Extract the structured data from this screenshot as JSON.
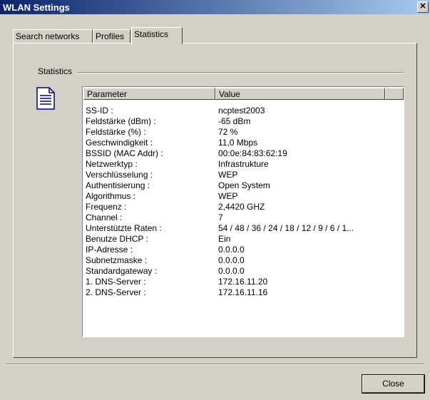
{
  "window": {
    "title": "WLAN Settings",
    "close_glyph": "✕"
  },
  "tabs": [
    {
      "label": "Search networks",
      "active": false
    },
    {
      "label": "Profiles",
      "active": false
    },
    {
      "label": "Statistics",
      "active": true
    }
  ],
  "group": {
    "label": "Statistics",
    "icon": "document-icon"
  },
  "table": {
    "headers": [
      "Parameter",
      "Value"
    ],
    "rows": [
      [
        "SS-ID :",
        "ncptest2003"
      ],
      [
        "Feldstärke (dBm) :",
        "-65 dBm"
      ],
      [
        "Feldstärke (%) :",
        "72 %"
      ],
      [
        "Geschwindigkeit :",
        "11,0 Mbps"
      ],
      [
        "BSSID (MAC Addr) :",
        "00:0e:84:83:62:19"
      ],
      [
        "Netzwerktyp :",
        "Infrastrukture"
      ],
      [
        "Verschlüsselung :",
        "WEP"
      ],
      [
        "Authentisierung :",
        "Open System"
      ],
      [
        "Algorithmus :",
        "WEP"
      ],
      [
        "Frequenz :",
        "2,4420 GHZ"
      ],
      [
        "Channel :",
        "7"
      ],
      [
        "Unterstützte Raten :",
        "54 / 48 / 36 / 24 / 18 / 12 / 9 / 6 / 1..."
      ],
      [
        "Benutze DHCP :",
        "Ein"
      ],
      [
        "IP-Adresse :",
        "0.0.0.0"
      ],
      [
        "Subnetzmaske :",
        "0.0.0.0"
      ],
      [
        "Standardgateway :",
        "0.0.0.0"
      ],
      [
        "1. DNS-Server :",
        "172.16.11.20"
      ],
      [
        "2. DNS-Server :",
        "172.16.11.16"
      ]
    ]
  },
  "buttons": {
    "close": "Close"
  },
  "colors": {
    "dialog_bg": "#d4d0c8",
    "titlebar_start": "#0a246a",
    "titlebar_end": "#a6caf0"
  }
}
